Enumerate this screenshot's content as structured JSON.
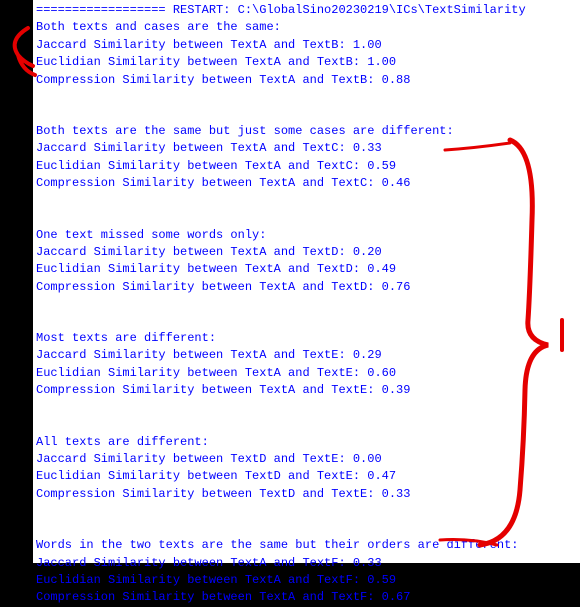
{
  "restart_line": "================== RESTART: C:\\GlobalSino20230219\\ICs\\TextSimilarity",
  "sections": [
    {
      "header": "Both texts and cases are the same:",
      "lines": [
        "Jaccard Similarity between TextA and TextB:  1.00",
        "Euclidian Similarity between TextA and TextB:  1.00",
        "Compression Similarity between TextA and TextB: 0.88"
      ]
    },
    {
      "header": "Both texts are the same but just some cases are different:",
      "lines": [
        "Jaccard Similarity between TextA and TextC:  0.33",
        "Euclidian Similarity between TextA and TextC:  0.59",
        "Compression Similarity between TextA and TextC: 0.46"
      ]
    },
    {
      "header": "One text missed some words only:",
      "lines": [
        "Jaccard Similarity between TextA and TextD:  0.20",
        "Euclidian Similarity between TextA and TextD:  0.49",
        "Compression Similarity between TextA and TextD: 0.76"
      ]
    },
    {
      "header": "Most texts are different:",
      "lines": [
        "Jaccard Similarity between TextA and TextE:  0.29",
        "Euclidian Similarity between TextA and TextE:  0.60",
        "Compression Similarity between TextA and TextE: 0.39"
      ]
    },
    {
      "header": "All texts are different:",
      "lines": [
        "Jaccard Similarity between TextD and TextE:  0.00",
        "Euclidian Similarity between TextD and TextE:  0.47",
        "Compression Similarity between TextD and TextE: 0.33"
      ]
    },
    {
      "header": "Words in the two texts are the same but their orders are different:",
      "lines": [
        "Jaccard Similarity between TextA and TextF:  0.33",
        "Euclidian Similarity between TextA and TextF:  0.59",
        "Compression Similarity between TextA and TextF: 0.67"
      ]
    }
  ]
}
